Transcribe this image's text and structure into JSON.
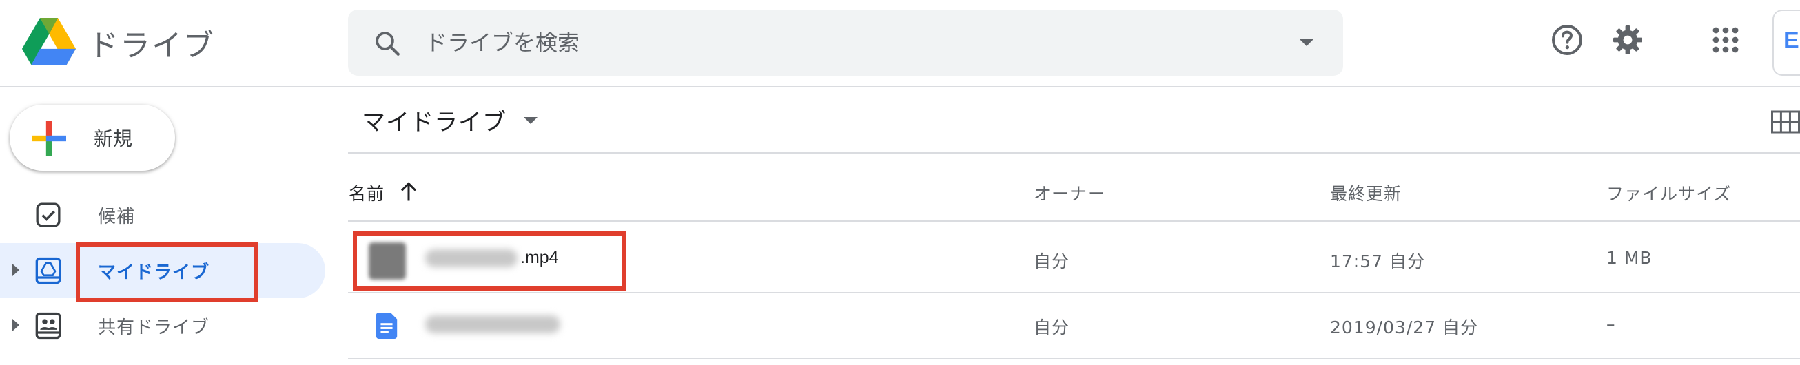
{
  "header": {
    "app_title": "ドライブ",
    "search_placeholder": "ドライブを検索",
    "account_initial": "E"
  },
  "sidebar": {
    "new_label": "新規",
    "items": [
      {
        "label": "候補",
        "icon": "suggested-icon"
      },
      {
        "label": "マイドライブ",
        "icon": "my-drive-icon",
        "active": true
      },
      {
        "label": "共有ドライブ",
        "icon": "shared-drives-icon"
      }
    ]
  },
  "main": {
    "folder_title": "マイドライブ",
    "columns": [
      "名前",
      "オーナー",
      "最終更新",
      "ファイルサイズ"
    ],
    "sort_direction": "ascending",
    "rows": [
      {
        "name_suffix": ".mp4",
        "owner": "自分",
        "modified": "17:57 自分",
        "size": "1 MB",
        "type": "video"
      },
      {
        "name_suffix": "",
        "owner": "自分",
        "modified": "2019/03/27 自分",
        "size": "–",
        "type": "document"
      }
    ]
  },
  "colors": {
    "accent": "#1967d2",
    "active_bg": "#e8f0fe",
    "highlight": "#e03e2d",
    "doc_blue": "#4285f4"
  }
}
